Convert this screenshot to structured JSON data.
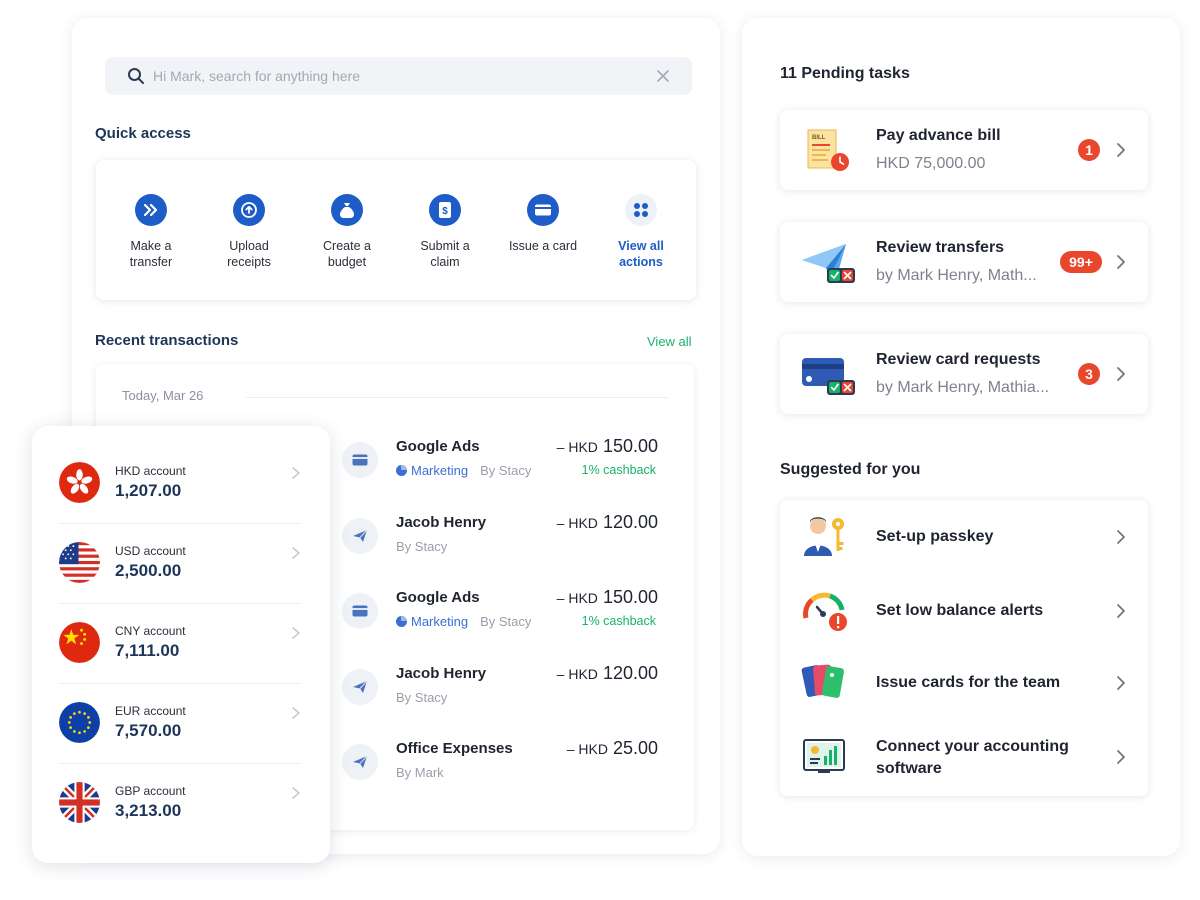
{
  "search": {
    "placeholder": "Hi Mark, search for anything here"
  },
  "quick_access": {
    "title": "Quick access",
    "items": [
      {
        "line1": "Make a",
        "line2": "transfer",
        "icon": "double-chevron-icon"
      },
      {
        "line1": "Upload",
        "line2": "receipts",
        "icon": "upload-icon"
      },
      {
        "line1": "Create a",
        "line2": "budget",
        "icon": "money-bag-icon"
      },
      {
        "line1": "Submit a",
        "line2": "claim",
        "icon": "receipt-icon"
      },
      {
        "line1": "Issue a card",
        "line2": "",
        "icon": "card-icon"
      },
      {
        "line1": "View all",
        "line2": "actions",
        "icon": "grid-icon"
      }
    ]
  },
  "transactions": {
    "title": "Recent transactions",
    "view_all": "View all",
    "date": "Today, Mar 26",
    "rows": [
      {
        "name": "Google Ads",
        "tag": "Marketing",
        "by": "By Stacy",
        "sign": "–",
        "currency": "HKD",
        "amount": "150.00",
        "cashback": "1% cashback",
        "icon": "card-icon"
      },
      {
        "name": "Jacob Henry",
        "tag": "",
        "by": "By Stacy",
        "sign": "–",
        "currency": "HKD",
        "amount": "120.00",
        "cashback": "",
        "icon": "paper-plane-icon"
      },
      {
        "name": "Google Ads",
        "tag": "Marketing",
        "by": "By Stacy",
        "sign": "–",
        "currency": "HKD",
        "amount": "150.00",
        "cashback": "1% cashback",
        "icon": "card-icon"
      },
      {
        "name": "Jacob Henry",
        "tag": "",
        "by": "By Stacy",
        "sign": "–",
        "currency": "HKD",
        "amount": "120.00",
        "cashback": "",
        "icon": "paper-plane-icon"
      },
      {
        "name": "Office Expenses",
        "tag": "",
        "by": "By Mark",
        "sign": "–",
        "currency": "HKD",
        "amount": "25.00",
        "cashback": "",
        "icon": "paper-plane-icon"
      }
    ]
  },
  "accounts": [
    {
      "label": "HKD account",
      "value": "1,207.00",
      "flag": "hong-kong-flag-icon"
    },
    {
      "label": "USD account",
      "value": "2,500.00",
      "flag": "us-flag-icon"
    },
    {
      "label": "CNY account",
      "value": "7,111.00",
      "flag": "china-flag-icon"
    },
    {
      "label": "EUR account",
      "value": "7,570.00",
      "flag": "eu-flag-icon"
    },
    {
      "label": "GBP account",
      "value": "3,213.00",
      "flag": "uk-flag-icon"
    }
  ],
  "pending": {
    "title": "11 Pending tasks",
    "tasks": [
      {
        "title": "Pay advance bill",
        "subtitle": "HKD 75,000.00",
        "badge": "1",
        "icon": "bill-illustration"
      },
      {
        "title": "Review transfers",
        "subtitle": "by Mark Henry, Math...",
        "badge": "99+",
        "icon": "transfer-illustration"
      },
      {
        "title": "Review card requests",
        "subtitle": "by Mark Henry, Mathia...",
        "badge": "3",
        "icon": "card-request-illustration"
      }
    ]
  },
  "suggested": {
    "title": "Suggested for you",
    "items": [
      {
        "title": "Set-up passkey",
        "icon": "passkey-illustration"
      },
      {
        "title": "Set low balance alerts",
        "icon": "gauge-alert-illustration"
      },
      {
        "title": "Issue cards for the team",
        "icon": "team-cards-illustration"
      },
      {
        "title": "Connect your accounting software",
        "icon": "accounting-illustration"
      }
    ]
  },
  "colors": {
    "primary": "#1e5cc8",
    "success": "#17b26a",
    "badge": "#e8472c",
    "heading": "#1d3557"
  }
}
